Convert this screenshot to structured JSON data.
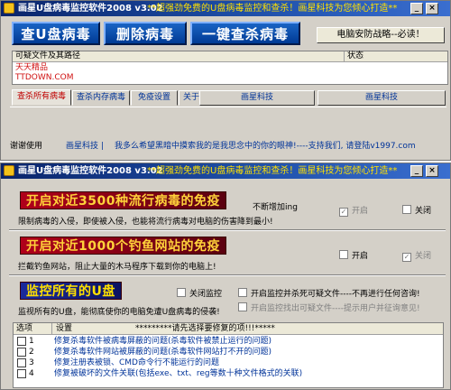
{
  "window1": {
    "title": "画星U盘病毒监控软件2008 v3.02",
    "title_slogan": "**超强劲免费的U盘病毒监控和查杀！画星科技为您倾心打造**",
    "buttons": {
      "scan": "查U盘病毒",
      "kill": "删除病毒",
      "onekey": "一键查杀病毒",
      "security": "电脑安防战略--必读！"
    },
    "list": {
      "col_path": "可疑文件及其路径",
      "col_status": "状态",
      "rows": [
        "天天精品",
        "TTDOWN.COM"
      ]
    },
    "tabs": [
      "查杀所有病毒",
      "查杀内存病毒",
      "免疫设置",
      "关于"
    ],
    "studio_buttons": [
      "画星科技",
      "画星科技"
    ],
    "status": {
      "thanks": "谢谢使用",
      "brand": "画星科技 |",
      "message": "我多么希望黑暗中摸索我的是我思念中的你的眼神!----支持我们, 请登陆v1997.com"
    }
  },
  "window2": {
    "title": "画星U盘病毒监控软件2008 v3.02",
    "title_slogan": "**超强劲免费的U盘病毒监控和查杀！画星科技为您倾心打造**",
    "immune1": {
      "banner": "开启对近3500种流行病毒的免疫",
      "tag": "不断增加ing",
      "desc": "限制病毒的入侵，即使被入侵，也能将流行病毒对电脑的伤害降到最小!",
      "on": "开启",
      "off": "关闭"
    },
    "immune2": {
      "banner": "开启对近1000个钓鱼网站的免疫",
      "desc": "拦截钓鱼网站，阻止大量的木马程序下载到你的电脑上!",
      "on": "开启",
      "off": "关闭"
    },
    "monitor": {
      "banner": "监控所有的U盘",
      "off": "关闭监控",
      "kill_option": "开启监控并杀死可疑文件----不再进行任何咨询!",
      "prompt_option": "开启监控找出可疑文件----提示用户并征询意见!",
      "desc": "监视所有的U盘，能彻底使你的电脑免遭U盘病毒的侵袭!"
    },
    "grid": {
      "col_option": "选项",
      "col_setting": "设置",
      "hint": "*********请先选择要修复的项!!!*****",
      "rows": [
        {
          "num": "1",
          "text": "修复杀毒软件被病毒屏蔽的问题(杀毒软件被禁止运行的问题)"
        },
        {
          "num": "2",
          "text": "修复杀毒软件网站被屏蔽的问题(杀毒软件网站打不开的问题)"
        },
        {
          "num": "3",
          "text": "修复注册表被锁、CMD命令行不能运行的问题"
        },
        {
          "num": "4",
          "text": "修复被破坏的文件关联(包括exe、txt、reg等数十种文件格式的关联)"
        }
      ]
    }
  },
  "colors": {
    "titlebar_start": "#0a246a",
    "titlebar_end": "#3a6ecf",
    "slogan": "#ffe000",
    "button_blue": "#1a64c4",
    "banner_red": "#b0001a",
    "banner_blue": "#1a2a9c",
    "link_blue": "#003399",
    "alert_red": "#c00000"
  }
}
